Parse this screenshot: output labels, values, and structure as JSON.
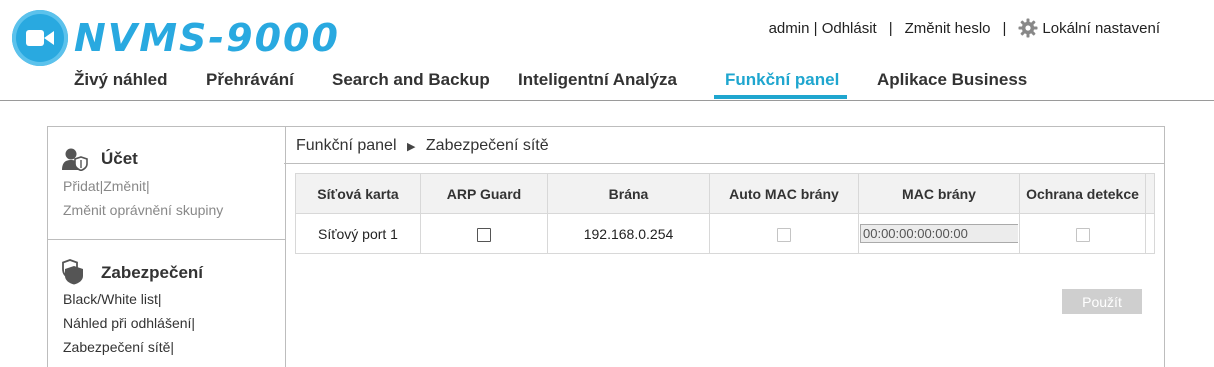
{
  "app": {
    "logo_text": "NVMS-9000"
  },
  "top_links": {
    "user": "admin",
    "logout": "Odhlásit",
    "change_password": "Změnit heslo",
    "local_settings": "Lokální nastavení"
  },
  "nav": {
    "tabs": [
      {
        "label": "Živý náhled"
      },
      {
        "label": "Přehrávání"
      },
      {
        "label": "Search and Backup"
      },
      {
        "label": "Inteligentní Analýza"
      },
      {
        "label": "Funkční panel"
      },
      {
        "label": "Aplikace Business"
      }
    ],
    "active_tab": "Funkční panel"
  },
  "sidebar": {
    "account": {
      "title": "Účet",
      "links": [
        "Přidat|Změnit|",
        "Změnit oprávnění skupiny"
      ]
    },
    "security": {
      "title": "Zabezpečení",
      "links": [
        "Black/White list|",
        "Náhled při odhlášení|",
        "Zabezpečení sítě|"
      ]
    }
  },
  "breadcrumb": {
    "root": "Funkční panel",
    "current": "Zabezpečení sítě"
  },
  "table": {
    "headers": [
      "Síťová karta",
      "ARP Guard",
      "Brána",
      "Auto MAC brány",
      "MAC brány",
      "Ochrana detekce"
    ],
    "rows": [
      {
        "network_card": "Síťový port 1",
        "arp_guard": false,
        "gateway": "192.168.0.254",
        "auto_mac": false,
        "mac": "00:00:00:00:00:00",
        "detection_protection": false
      }
    ]
  },
  "buttons": {
    "apply": "Použít"
  },
  "colors": {
    "accent": "#1fa6cf",
    "logo": "#29a9e0"
  }
}
